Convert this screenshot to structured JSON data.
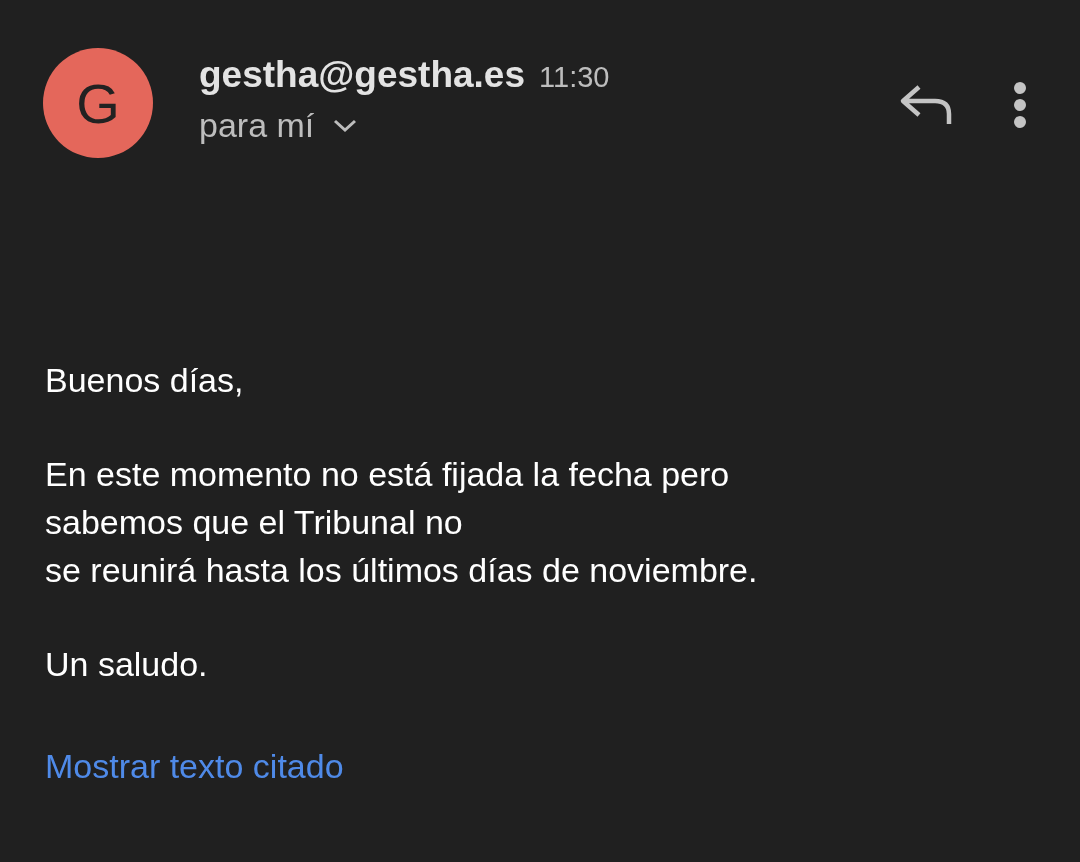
{
  "avatar": {
    "letter": "G",
    "color": "#e4675b"
  },
  "header": {
    "sender": "gestha@gestha.es",
    "time": "11:30",
    "recipient": "para mí"
  },
  "body": {
    "paragraphs": [
      "Buenos días,",
      "En este momento no está fijada la fecha pero\nsabemos que el Tribunal no\nse reunirá hasta los últimos días de noviembre.",
      "Un saludo."
    ],
    "link": "Mostrar texto citado"
  }
}
